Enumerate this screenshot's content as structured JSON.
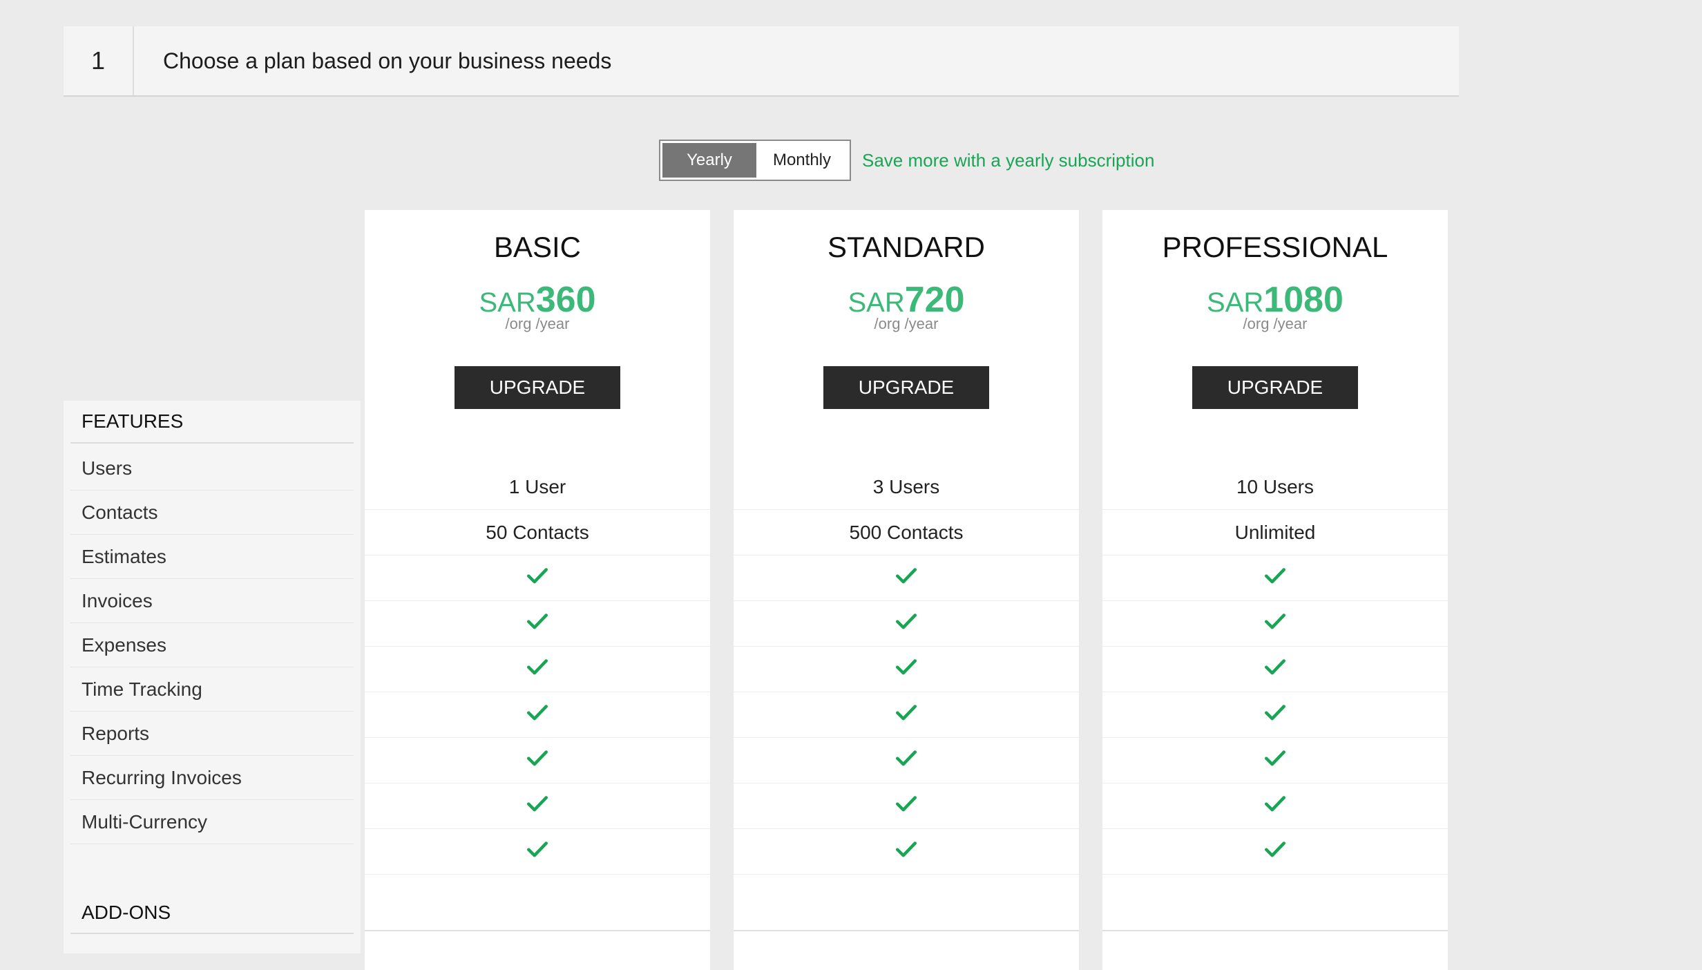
{
  "step": {
    "number": "1",
    "title": "Choose a plan based on your business needs"
  },
  "billing": {
    "yearly": "Yearly",
    "monthly": "Monthly",
    "selected": "Yearly",
    "save_message": "Save more with a yearly subscription"
  },
  "features": {
    "heading": "FEATURES",
    "items": [
      "Users",
      "Contacts",
      "Estimates",
      "Invoices",
      "Expenses",
      "Time Tracking",
      "Reports",
      "Recurring Invoices",
      "Multi-Currency"
    ],
    "addons_heading": "ADD-ONS"
  },
  "plans": [
    {
      "name": "BASIC",
      "currency": "SAR",
      "amount": "360",
      "period": "/org /year",
      "button": "UPGRADE",
      "users": "1 User",
      "contacts": "50 Contacts"
    },
    {
      "name": "STANDARD",
      "currency": "SAR",
      "amount": "720",
      "period": "/org /year",
      "button": "UPGRADE",
      "users": "3 Users",
      "contacts": "500 Contacts"
    },
    {
      "name": "PROFESSIONAL",
      "currency": "SAR",
      "amount": "1080",
      "period": "/org /year",
      "button": "UPGRADE",
      "users": "10 Users",
      "contacts": "Unlimited"
    }
  ],
  "colors": {
    "accent_green": "#3cb878",
    "check_green": "#1aa455",
    "button_dark": "#2b2b2b"
  },
  "icons": {
    "included": "check-icon"
  }
}
